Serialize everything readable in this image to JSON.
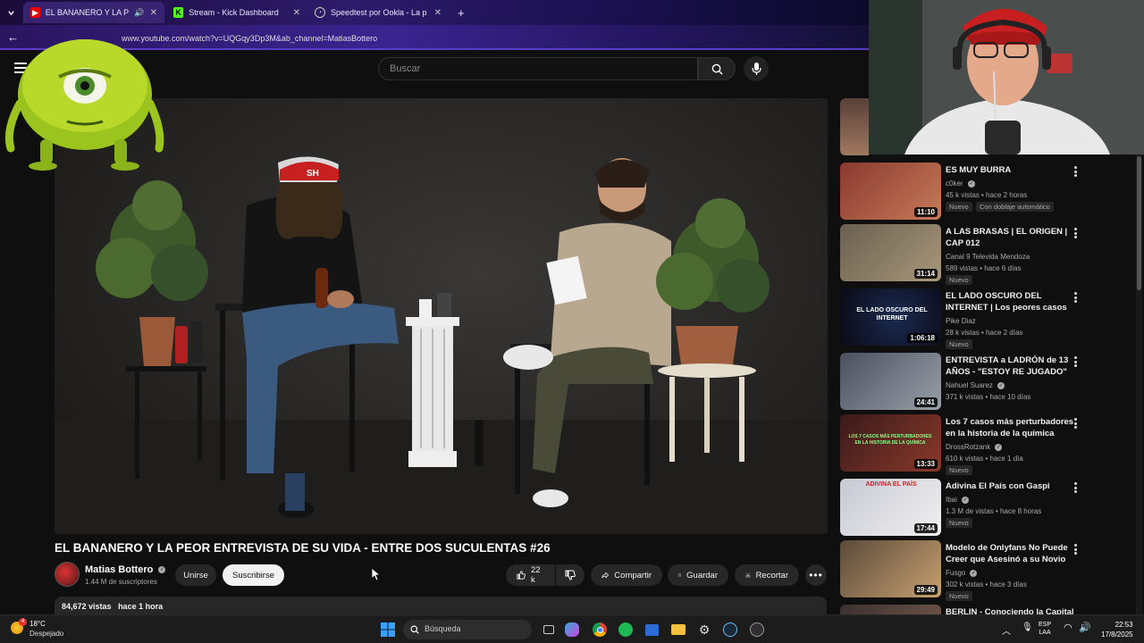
{
  "browser": {
    "tabs": [
      {
        "label": "EL BANANERO Y LA PEOR E",
        "active": true
      },
      {
        "label": "Stream - Kick Dashboard",
        "active": false
      },
      {
        "label": "Speedtest por Ookla - La prueb",
        "active": false
      }
    ],
    "new_tab": "+",
    "url": "www.youtube.com/watch?v=UQGqy3Dp3M&ab_channel=MatiasBottero"
  },
  "youtube": {
    "search_placeholder": "Buscar",
    "video": {
      "title": "EL BANANERO Y LA PEOR ENTREVISTA DE SU VIDA - ENTRE DOS SUCULENTAS #26",
      "channel": "Matias Bottero",
      "subscribers": "1.44 M de suscriptores",
      "join_label": "Unirse",
      "subscribe_label": "Suscribirse",
      "likes": "22 k",
      "share_label": "Compartir",
      "save_label": "Guardar",
      "clip_label": "Recortar",
      "views": "84,672 vistas",
      "date": "hace 1 hora",
      "shirt_text": "SH"
    },
    "recommendations": [
      {
        "title": "ES MUY BURRA",
        "channel": "c0ker",
        "meta": "45 k vistas • hace 2 horas",
        "badge": "Nuevo",
        "dub": "Con doblaje automático",
        "duration": "11:10",
        "colors": [
          "#8a3a2e",
          "#c77a5a"
        ]
      },
      {
        "title": "A LAS BRASAS | EL ORIGEN | CAP 012",
        "channel": "Canal 9 Televida Mendoza",
        "meta": "589 vistas • hace 6 días",
        "badge": "Nuevo",
        "duration": "31:14",
        "colors": [
          "#6a6050",
          "#a8987a"
        ]
      },
      {
        "title": "EL LADO OSCURO DEL INTERNET | Los peores casos",
        "channel": "Pike Diaz",
        "meta": "28 k vistas • hace 2 días",
        "badge": "Nuevo",
        "duration": "1:06:18",
        "thumb_text": "EL LADO OSCURO DEL INTERNET",
        "colors": [
          "#0a0a14",
          "#1a2a50"
        ]
      },
      {
        "title": "ENTREVISTA a LADRÓN de 13 AÑOS - \"ESTOY RE JUGADO\"",
        "channel": "Nahuel Suarez",
        "meta": "371 k vistas • hace 10 días",
        "duration": "24:41",
        "colors": [
          "#4a5060",
          "#9aa0a8"
        ]
      },
      {
        "title": "Los 7 casos más perturbadores en la historia de la química",
        "channel": "DrossRotzank",
        "meta": "610 k vistas • hace 1 día",
        "badge": "Nuevo",
        "duration": "13:33",
        "thumb_text": "LOS 7 CASOS MÁS PERTURBADORES EN LA HISTORIA DE LA QUÍMICA",
        "colors": [
          "#3a1a1a",
          "#8a3a2a"
        ]
      },
      {
        "title": "Adivina El País con Gaspi",
        "channel": "Ibai",
        "meta": "1.3 M de vistas • hace 8 horas",
        "badge": "Nuevo",
        "duration": "17:44",
        "thumb_text": "ADIVINA EL PAÍS",
        "colors": [
          "#d8d8e0",
          "#f0f0f0"
        ]
      },
      {
        "title": "Modelo de Onlyfans No Puede Creer que Asesinó a su Novio",
        "channel": "Fusgo",
        "meta": "302 k vistas • hace 3 días",
        "badge": "Nuevo",
        "duration": "29:49",
        "colors": [
          "#5a4a3a",
          "#c8a070"
        ]
      },
      {
        "title": "BERLIN - Conociendo la Capital",
        "channel": "",
        "meta": "",
        "duration": "",
        "colors": [
          "#3a3030",
          "#806050"
        ]
      }
    ]
  },
  "taskbar": {
    "temperature": "18°C",
    "weather": "Despejado",
    "search_placeholder": "Búsqueda",
    "notification_count": "4",
    "language": "ESP",
    "region": "LAA",
    "time": "22:53",
    "date": "17/8/2025"
  },
  "colors": {
    "yt_bg": "#0f0f0f",
    "pill": "#272727",
    "subscribe_bg": "#f1f1f1",
    "muted": "#aaaaaa",
    "browser_accent": "#5a3cc8"
  },
  "icons": [
    "chevron-down-icon",
    "youtube-favicon",
    "kick-favicon",
    "speedtest-favicon",
    "close-icon",
    "back-arrow-icon",
    "menu-icon",
    "search-icon",
    "mic-icon",
    "verified-icon",
    "thumbs-up-icon",
    "thumbs-down-icon",
    "share-icon",
    "bookmark-icon",
    "scissors-icon",
    "more-icon",
    "windows-start-icon",
    "spotify-icon",
    "chrome-icon",
    "folder-icon",
    "steam-icon",
    "wifi-icon",
    "volume-icon"
  ]
}
